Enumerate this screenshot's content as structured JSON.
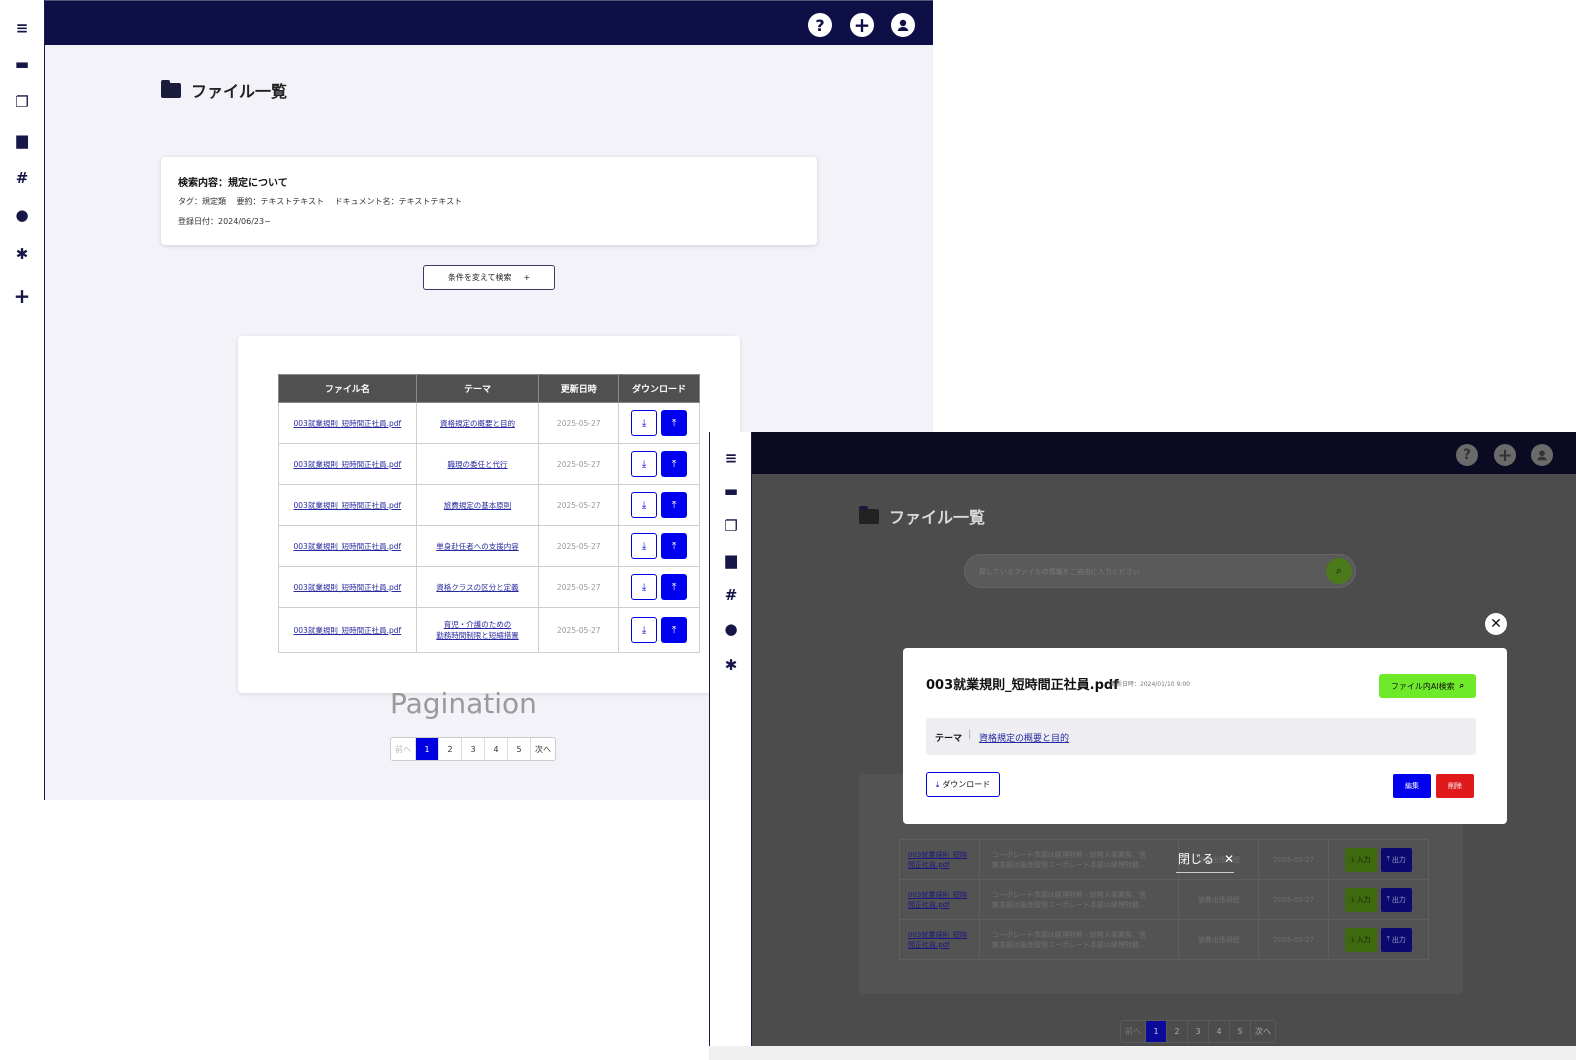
{
  "screen_a": {
    "sidebar_icons": [
      "menu-icon",
      "chat-icon",
      "copy-icon",
      "folder-icon",
      "hash-icon",
      "user-icon",
      "gear-icon",
      "plus-icon"
    ],
    "header_icons": [
      "help-icon",
      "add-circle-icon",
      "account-icon"
    ],
    "page_title": "ファイル一覧",
    "search_summary": {
      "title": "検索内容：規定について",
      "line2": "タグ：規定類　 要約：テキストテキスト　 ドキュメント名：テキストテキスト",
      "line3": "登録日付：2024/06/23~"
    },
    "research_button": "条件を変えて検索",
    "research_plus": "+",
    "table": {
      "headers": [
        "ファイル名",
        "テーマ",
        "更新日時",
        "ダウンロード"
      ],
      "rows": [
        {
          "file": "003就業規則_短時間正社員.pdf",
          "theme": "資格規定の概要と目的",
          "date": "2025-05-27"
        },
        {
          "file": "003就業規則_短時間正社員.pdf",
          "theme": "職現の委任と代行",
          "date": "2025-05-27"
        },
        {
          "file": "003就業規則_短時間正社員.pdf",
          "theme": "旅費規定の基本原則",
          "date": "2025-05-27"
        },
        {
          "file": "003就業規則_短時間正社員.pdf",
          "theme": "単身赴任者への支援内容",
          "date": "2025-05-27"
        },
        {
          "file": "003就業規則_短時間正社員.pdf",
          "theme": "資格クラスの区分と定義",
          "date": "2025-05-27"
        },
        {
          "file": "003就業規則_短時間正社員.pdf",
          "theme": "育児・介護のための\n勤務時間制限と短縮措置",
          "date": "2025-05-27"
        }
      ]
    },
    "pagination_label": "Pagination",
    "pager": {
      "prev": "前へ",
      "pages": [
        "1",
        "2",
        "3",
        "4",
        "5"
      ],
      "next": "次へ",
      "current": "1"
    }
  },
  "screen_b": {
    "sidebar_icons": [
      "menu-icon",
      "chat-icon",
      "copy-icon",
      "folder-icon",
      "hash-icon",
      "user-icon",
      "gear-icon"
    ],
    "page_title": "ファイル一覧",
    "search_placeholder": "探しているファイルの情報をご自由に入力ください",
    "background_rows": [
      {
        "file": "003就業規則_短時\n間正社員.pdf",
        "desc": "コーポレート本部は経理財務・総務人事業務、営\n業本部は販売管理コーポレート本部は経理財務...",
        "theme": "旅費出張規程",
        "date": "2025-05-27",
        "in": "入力",
        "out": "出力"
      },
      {
        "file": "003就業規則_短時\n間正社員.pdf",
        "desc": "コーポレート本部は経理財務・総務人事業務、営\n業本部は販売管理コーポレート本部は経理財務...",
        "theme": "旅費出張規程",
        "date": "2025-05-27",
        "in": "入力",
        "out": "出力"
      },
      {
        "file": "003就業規則_短時\n間正社員.pdf",
        "desc": "コーポレート本部は経理財務・総務人事業務、営\n業本部は販売管理コーポレート本部は経理財務...",
        "theme": "旅費出張規程",
        "date": "2025-05-27",
        "in": "入力",
        "out": "出力"
      }
    ],
    "pager": {
      "prev": "前へ",
      "pages": [
        "1",
        "2",
        "3",
        "4",
        "5"
      ],
      "next": "次へ",
      "current": "1"
    },
    "modal": {
      "title": "003就業規則_短時間正社員.pdf",
      "updated": "更新日時：2024/01/10 9:00",
      "ai_search": "ファイル内AI検索",
      "theme_key": "テーマ",
      "theme_value": "資格規定の概要と目的",
      "download": "ダウンロード",
      "edit": "編集",
      "delete": "削除"
    },
    "close_label": "閉じる"
  }
}
